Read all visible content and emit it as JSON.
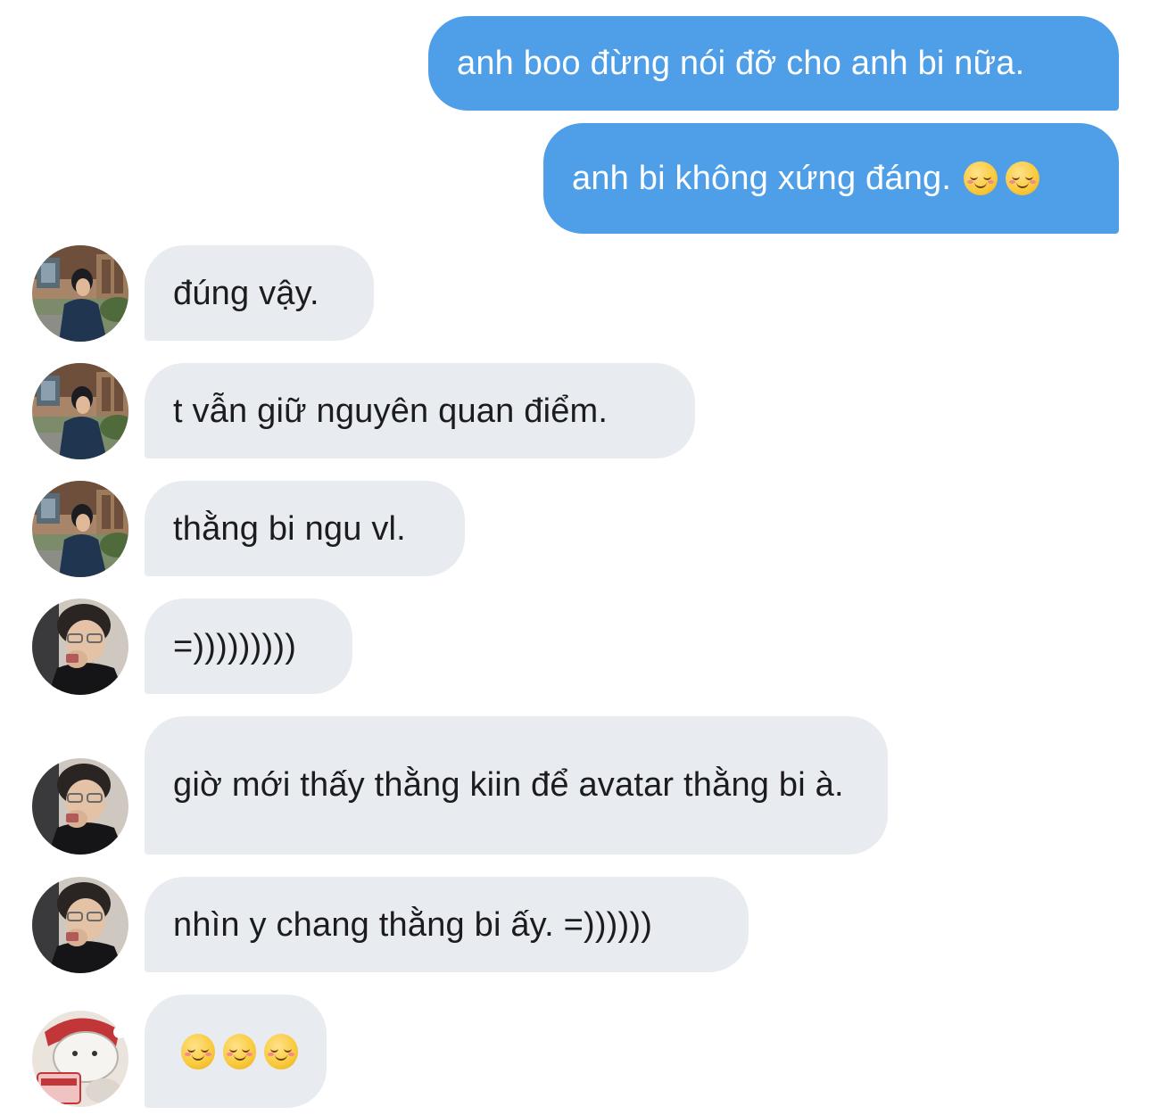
{
  "messages": [
    {
      "direction": "outgoing",
      "text": "anh boo đừng nói đỡ cho anh bi nữa."
    },
    {
      "direction": "outgoing",
      "text": "anh bi không xứng đáng.",
      "emoji": [
        "smiling-face-icon",
        "smiling-face-icon"
      ]
    },
    {
      "direction": "incoming",
      "avatar": "avatar-1",
      "text": "đúng vậy."
    },
    {
      "direction": "incoming",
      "avatar": "avatar-1",
      "text": "t vẫn giữ nguyên quan điểm."
    },
    {
      "direction": "incoming",
      "avatar": "avatar-1",
      "text": "thằng bi ngu vl."
    },
    {
      "direction": "incoming",
      "avatar": "avatar-2",
      "text": "=)))))))))"
    },
    {
      "direction": "incoming",
      "avatar": "avatar-2",
      "text": "giờ mới thấy thằng kiin để avatar thằng bi à."
    },
    {
      "direction": "incoming",
      "avatar": "avatar-2",
      "text": "nhìn y chang thằng bi ấy. =))))))"
    },
    {
      "direction": "incoming",
      "avatar": "avatar-3",
      "text": "",
      "emoji": [
        "smiling-face-icon",
        "smiling-face-icon",
        "smiling-face-icon"
      ]
    }
  ],
  "colors": {
    "outgoing_bubble": "#4e9ee8",
    "incoming_bubble": "#e8ecf0",
    "outgoing_text": "#ffffff",
    "incoming_text": "#1c1c1e"
  }
}
